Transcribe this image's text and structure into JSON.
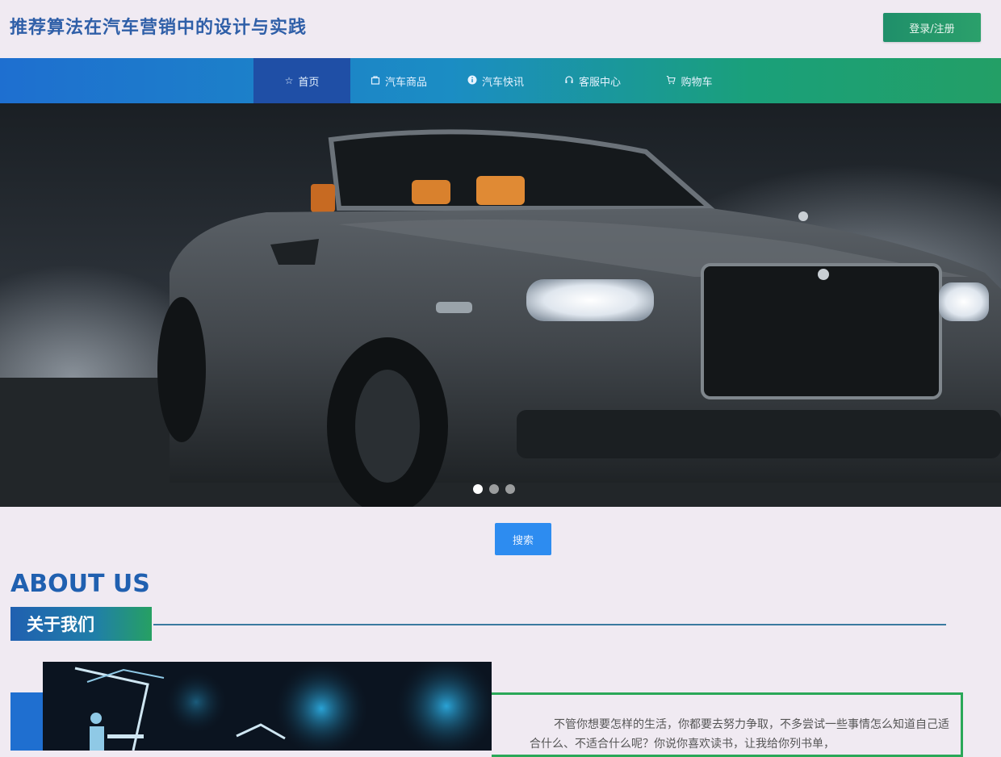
{
  "header": {
    "site_title": "推荐算法在汽车营销中的设计与实践",
    "login_label": "登录/注册"
  },
  "nav": {
    "items": [
      {
        "label": "首页",
        "icon": "star-icon",
        "active": true
      },
      {
        "label": "汽车商品",
        "icon": "bag-icon",
        "active": false
      },
      {
        "label": "汽车快讯",
        "icon": "info-icon",
        "active": false
      },
      {
        "label": "客服中心",
        "icon": "headset-icon",
        "active": false
      },
      {
        "label": "购物车",
        "icon": "cart-icon",
        "active": false
      }
    ]
  },
  "banner": {
    "slide_count": 3,
    "active_slide": 1
  },
  "search": {
    "placeholder": "",
    "button_label": "搜索"
  },
  "about": {
    "title_en": "ABOUT US",
    "title_cn": "关于我们",
    "paragraph": "不管你想要怎样的生活，你都要去努力争取，不多尝试一些事情怎么知道自己适合什么、不适合什么呢？你说你喜欢读书，让我给你列书单，"
  },
  "colors": {
    "accent_blue": "#1f6fd0",
    "accent_green": "#26a063",
    "nav_active": "#1f4fa6",
    "search_button": "#2d8cf0"
  }
}
